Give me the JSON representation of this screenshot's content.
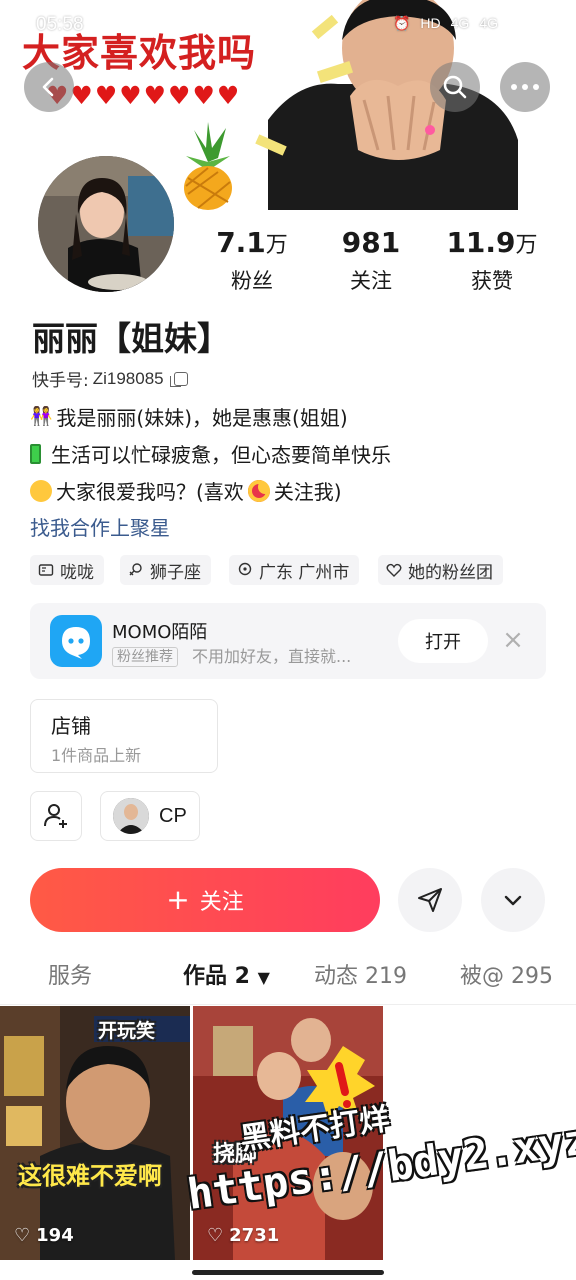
{
  "status_bar": {
    "time": "05:58",
    "icons": [
      "HD",
      "4G",
      "4G"
    ],
    "battery": "88"
  },
  "banner": {
    "title": "大家喜欢我吗",
    "hearts": "♥♥♥♥♥♥♥♥"
  },
  "profile": {
    "name": "丽丽【姐妹】",
    "id_label": "快手号:",
    "id_value": "Zi198085",
    "stats": [
      {
        "value": "7.1",
        "unit": "万",
        "label": "粉丝"
      },
      {
        "value": "981",
        "unit": "",
        "label": "关注"
      },
      {
        "value": "11.9",
        "unit": "万",
        "label": "获赞"
      }
    ],
    "bio": [
      "我是丽丽(妹妹)，她是惠惠(姐姐)",
      "生活可以忙碌疲惫，但心态要简单快乐",
      "大家很爱我吗？(喜欢",
      "关注我)"
    ],
    "link": "找我合作上聚星"
  },
  "tags": [
    {
      "icon": "id-card-icon",
      "label": "咙咙"
    },
    {
      "icon": "female-icon",
      "label": "狮子座"
    },
    {
      "icon": "location-icon",
      "label": "广东 广州市"
    },
    {
      "icon": "heart-outline-icon",
      "label": "她的粉丝团"
    }
  ],
  "app_card": {
    "name": "MOMO陌陌",
    "badge": "粉丝推荐",
    "description": "不用加好友，直接就...",
    "open_label": "打开",
    "close_label": "×"
  },
  "shop": {
    "title": "店铺",
    "subtitle": "1件商品上新"
  },
  "cp": {
    "label": "CP"
  },
  "actions": {
    "follow_label": "关注",
    "follow_plus": "+"
  },
  "tabs": [
    {
      "label": "服务"
    },
    {
      "label": "作品 2"
    },
    {
      "label": "动态 219"
    },
    {
      "label": "被@ 295"
    }
  ],
  "videos": [
    {
      "top_caption": "开玩笑",
      "caption": "这很难不爱啊",
      "likes": "194"
    },
    {
      "caption": "挠脚",
      "likes": "2731"
    }
  ],
  "watermark": {
    "line1": "黑料不打烊",
    "line2": "https://bdy2.xyz"
  },
  "colors": {
    "follow_gradient_start": "#ff5a45",
    "follow_gradient_end": "#ff3d5e",
    "link": "#3b5b8e",
    "momo_blue": "#1fa6f4",
    "banner_title": "#d42020"
  }
}
